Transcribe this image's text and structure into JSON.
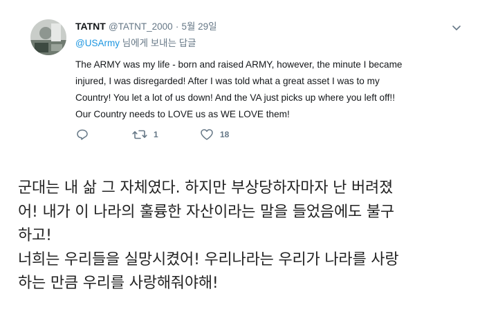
{
  "tweet": {
    "display_name": "TATNT",
    "handle": "@TATNT_2000",
    "separator": "·",
    "date": "5월 29일",
    "reply_to": {
      "mention": "@USArmy",
      "suffix": "님에게 보내는 답글"
    },
    "text_lines": [
      "The ARMY was my life - born and raised ARMY, however, the minute I became",
      "injured, I was disregarded! After I was told what a great asset I was to my",
      "Country! You let a lot of us down! And the VA just picks up where you left off!!",
      "Our Country needs to LOVE us as WE LOVE them!"
    ],
    "actions": {
      "reply_icon": "reply-icon",
      "retweet_icon": "retweet-icon",
      "retweet_count": "1",
      "like_icon": "heart-icon",
      "like_count": "18"
    },
    "menu_icon": "chevron-down-icon"
  },
  "translation": {
    "lines": [
      "군대는 내 삶 그 자체였다. 하지만 부상당하자마자 난 버려졌",
      "어! 내가 이 나라의 훌륭한 자산이라는 말을 들었음에도 불구",
      "하고!",
      "너희는 우리들을 실망시켰어! 우리나라는 우리가 나라를 사랑",
      "하는 만큼 우리를 사랑해줘야해!"
    ]
  },
  "colors": {
    "link": "#1b95e0",
    "secondary_text": "#657786",
    "primary_text": "#14171a",
    "body_text": "#222222"
  }
}
